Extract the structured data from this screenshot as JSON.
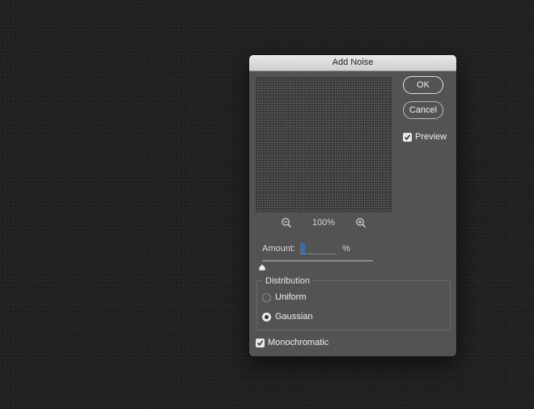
{
  "dialog": {
    "title": "Add Noise",
    "ok_label": "OK",
    "cancel_label": "Cancel",
    "preview_label": "Preview",
    "preview_checked": true,
    "zoom": {
      "level": "100%",
      "zoom_out_icon": "zoom-out-icon",
      "zoom_in_icon": "zoom-in-icon"
    },
    "amount": {
      "label": "Amount:",
      "value": "5",
      "unit": "%"
    },
    "slider_position": 0.0125,
    "distribution": {
      "label": "Distribution",
      "options": [
        "Uniform",
        "Gaussian"
      ],
      "selected": "Gaussian"
    },
    "monochromatic_label": "Monochromatic",
    "monochromatic_checked": true
  }
}
